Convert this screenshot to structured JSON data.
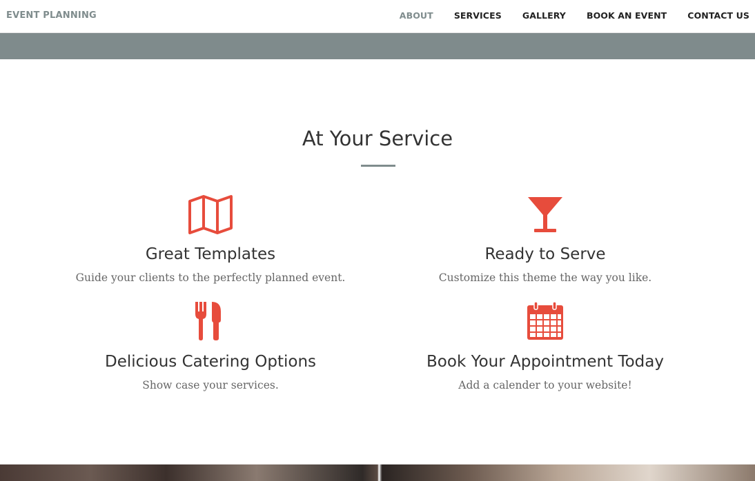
{
  "nav": {
    "brand": "EVENT PLANNING",
    "links": [
      {
        "label": "ABOUT",
        "active": true
      },
      {
        "label": "SERVICES",
        "active": false
      },
      {
        "label": "GALLERY",
        "active": false
      },
      {
        "label": "BOOK AN EVENT",
        "active": false
      },
      {
        "label": "CONTACT US",
        "active": false
      }
    ]
  },
  "section": {
    "title": "At Your Service"
  },
  "features": [
    {
      "icon": "map-icon",
      "title": "Great Templates",
      "text": "Guide your clients to the perfectly planned event."
    },
    {
      "icon": "cocktail-glass-icon",
      "title": "Ready to Serve",
      "text": "Customize this theme the way you like."
    },
    {
      "icon": "fork-knife-icon",
      "title": "Delicious Catering Options",
      "text": "Show case your services."
    },
    {
      "icon": "calendar-icon",
      "title": "Book Your Appointment Today",
      "text": "Add a calender to your website!"
    }
  ],
  "colors": {
    "accent": "#e74c3c",
    "nav_muted": "#7f8c8d",
    "banner": "#7f8b8c"
  }
}
